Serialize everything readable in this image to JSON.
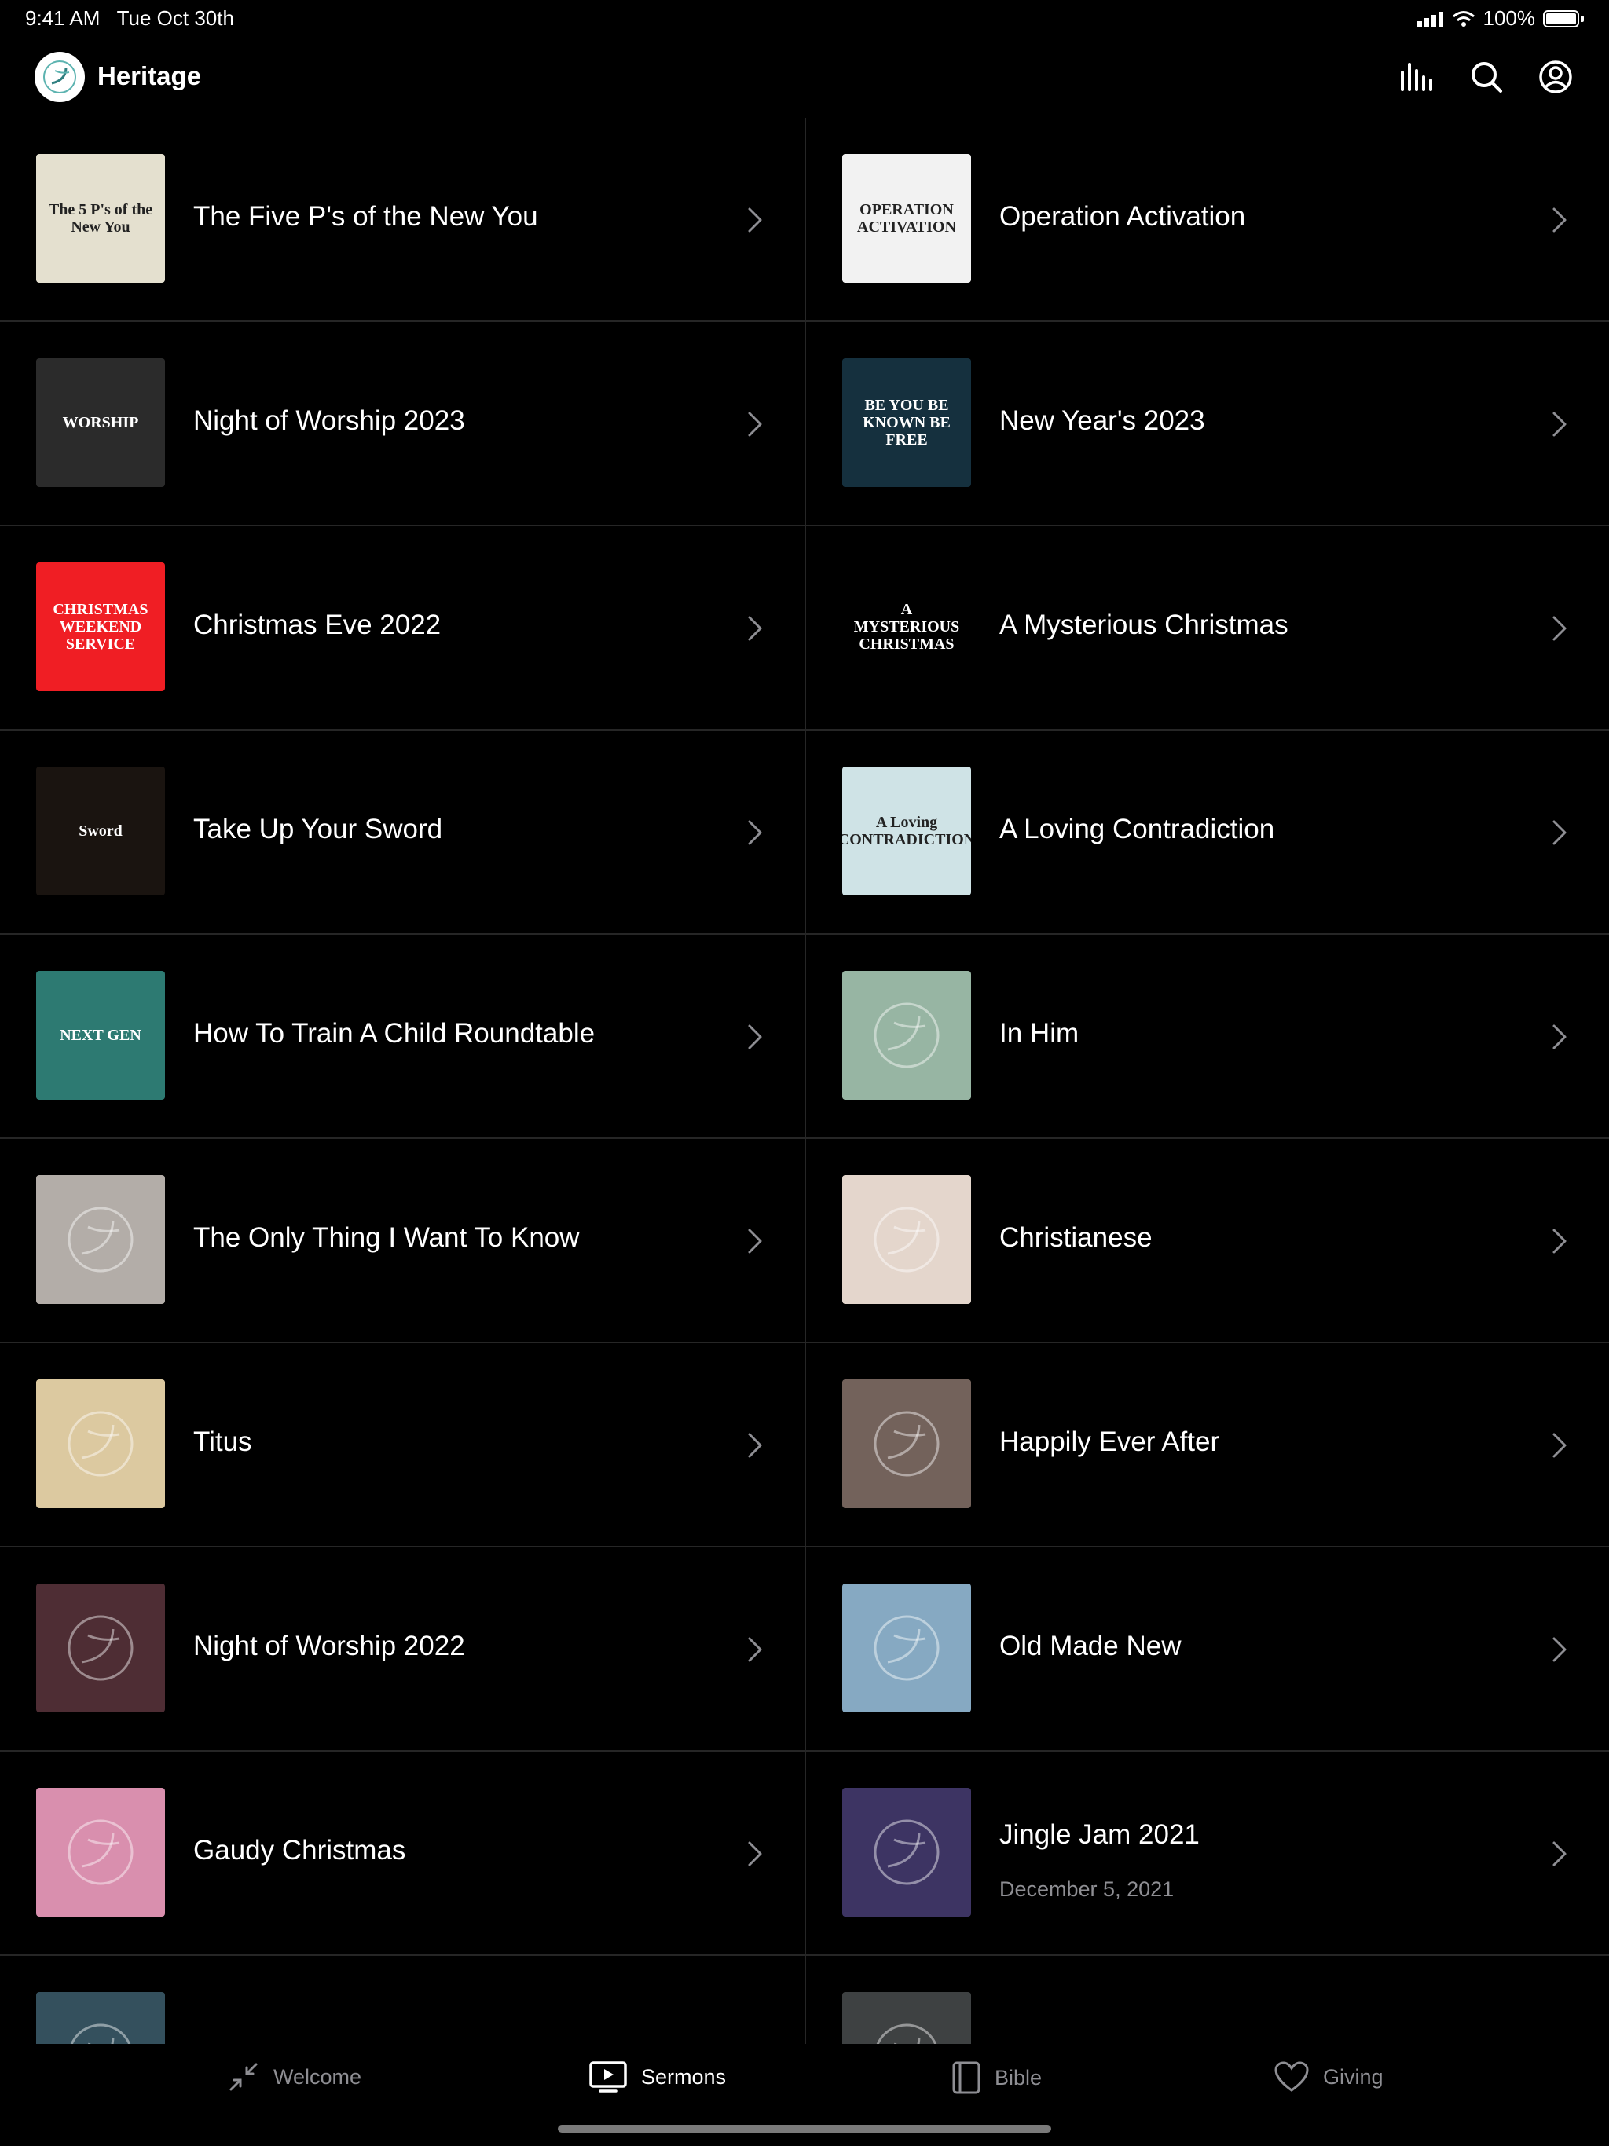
{
  "status_bar": {
    "time": "9:41 AM",
    "date": "Tue Oct 30th",
    "battery": "100%"
  },
  "header": {
    "title": "Heritage",
    "icons": [
      "equalizer-icon",
      "search-icon",
      "account-icon"
    ]
  },
  "sermons": [
    {
      "title": "The Five P's of the New You",
      "thumb_color": "#e4e0cf",
      "art": "text",
      "art_text": "The 5 P's of the New You"
    },
    {
      "title": "Operation Activation",
      "thumb_color": "#f2f2f2",
      "art": "text",
      "art_text": "OPERATION ACTIVATION"
    },
    {
      "title": "Night of Worship 2023",
      "thumb_color": "#2b2b2b",
      "art": "text",
      "art_text": "WORSHIP"
    },
    {
      "title": "New Year's 2023",
      "thumb_color": "#15303e",
      "art": "text",
      "art_text": "BE YOU BE KNOWN BE FREE"
    },
    {
      "title": "Christmas Eve 2022",
      "thumb_color": "#f01e24",
      "art": "text",
      "art_text": "CHRISTMAS WEEKEND SERVICE"
    },
    {
      "title": "A Mysterious Christmas",
      "thumb_color": "#000000",
      "art": "text",
      "art_text": "A MYSTERIOUS CHRISTMAS"
    },
    {
      "title": "Take Up Your Sword",
      "thumb_color": "#1a1410",
      "art": "text",
      "art_text": "Sword"
    },
    {
      "title": "A Loving Contradiction",
      "thumb_color": "#cfe3e6",
      "art": "text",
      "art_text": "A Loving CONTRADICTION"
    },
    {
      "title": "How To Train A Child Roundtable",
      "thumb_color": "#2d7a72",
      "art": "text",
      "art_text": "NEXT GEN"
    },
    {
      "title": "In Him",
      "thumb_color": "#97b5a3",
      "art": "logo"
    },
    {
      "title": "The Only Thing I Want To Know",
      "thumb_color": "#b3ada8",
      "art": "logo"
    },
    {
      "title": "Christianese",
      "thumb_color": "#e4d6cc",
      "art": "logo"
    },
    {
      "title": "Titus",
      "thumb_color": "#dcc9a0",
      "art": "logo"
    },
    {
      "title": "Happily Ever After",
      "thumb_color": "#73625b",
      "art": "logo"
    },
    {
      "title": "Night of Worship 2022",
      "thumb_color": "#4e2d34",
      "art": "logo"
    },
    {
      "title": "Old Made New",
      "thumb_color": "#86a9c2",
      "art": "logo"
    },
    {
      "title": "Gaudy Christmas",
      "thumb_color": "#d98fae",
      "art": "logo"
    },
    {
      "title": "Jingle Jam 2021",
      "subtitle": "December 5, 2021",
      "thumb_color": "#3d3463",
      "art": "logo"
    },
    {
      "title": "",
      "thumb_color": "#34505d",
      "art": "logo"
    },
    {
      "title": "",
      "thumb_color": "#3e4142",
      "art": "logo"
    }
  ],
  "tabs": [
    {
      "label": "Welcome",
      "icon": "collapse-arrows-icon",
      "active": false
    },
    {
      "label": "Sermons",
      "icon": "tv-play-icon",
      "active": true
    },
    {
      "label": "Bible",
      "icon": "book-icon",
      "active": false
    },
    {
      "label": "Giving",
      "icon": "heart-icon",
      "active": false
    }
  ],
  "colors": {
    "background": "#000000",
    "divider": "#262626",
    "secondary_text": "#8e8e93"
  }
}
